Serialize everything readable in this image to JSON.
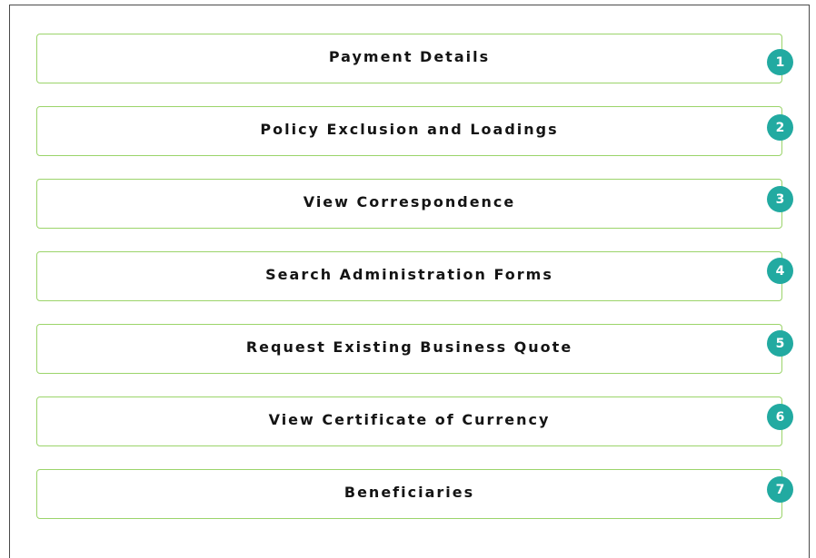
{
  "menu": {
    "items": [
      {
        "label": "Payment Details",
        "badge": "1"
      },
      {
        "label": "Policy Exclusion and Loadings",
        "badge": "2"
      },
      {
        "label": "View Correspondence",
        "badge": "3"
      },
      {
        "label": "Search Administration Forms",
        "badge": "4"
      },
      {
        "label": "Request Existing Business Quote",
        "badge": "5"
      },
      {
        "label": "View Certificate of Currency",
        "badge": "6"
      },
      {
        "label": "Beneficiaries",
        "badge": "7"
      }
    ]
  },
  "colors": {
    "item_border": "#9bd46a",
    "badge_background": "#22aaa1",
    "badge_text": "#ffffff",
    "label_text": "#141414",
    "frame_border": "#4a4a4a"
  }
}
